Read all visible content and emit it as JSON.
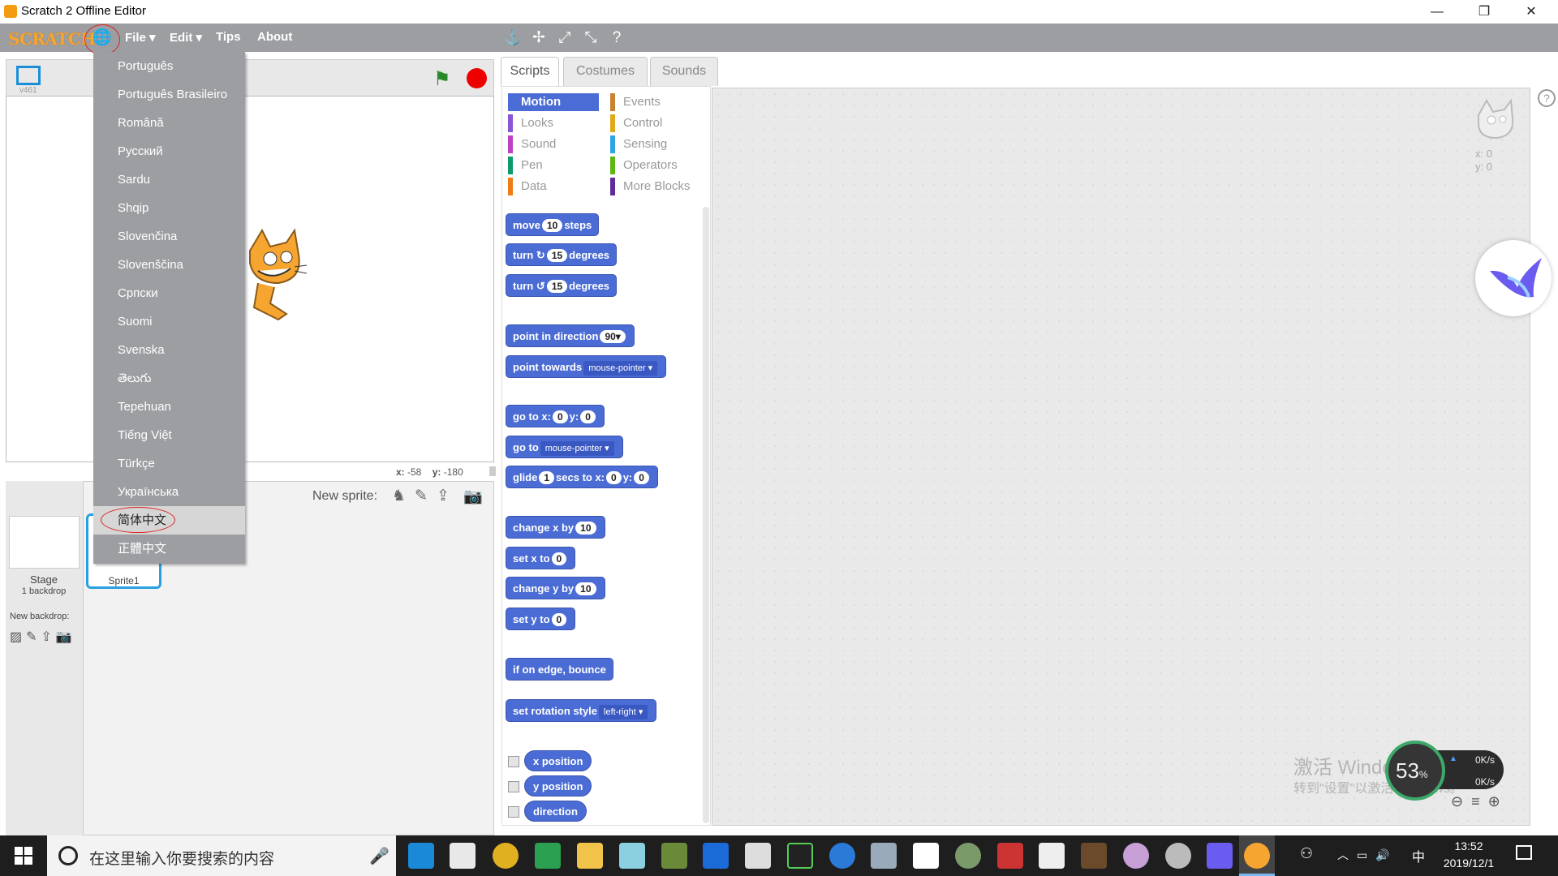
{
  "window": {
    "title": "Scratch 2 Offline Editor",
    "min": "—",
    "restore": "❐",
    "close": "✕"
  },
  "menubar": {
    "logo": "SCRATCH",
    "file": "File ▾",
    "edit": "Edit ▾",
    "tips": "Tips",
    "about": "About"
  },
  "language_menu": {
    "items": [
      "Português",
      "Português Brasileiro",
      "Română",
      "Русский",
      "Sardu",
      "Shqip",
      "Slovenčina",
      "Slovenščina",
      "Српски",
      "Suomi",
      "Svenska",
      "తెలుగు",
      "Tepehuan",
      "Tiếng Việt",
      "Türkçe",
      "Українська",
      "简体中文",
      "正體中文"
    ],
    "highlighted": "简体中文"
  },
  "stage": {
    "version": "v461",
    "x_label": "x:",
    "x_value": "-58",
    "y_label": "y:",
    "y_value": "-180"
  },
  "sprites": {
    "new_sprite": "New sprite:",
    "stage_label": "Stage",
    "stage_sub": "1 backdrop",
    "new_backdrop": "New backdrop:",
    "sprite_name": "Sprite1"
  },
  "tabs": [
    "Scripts",
    "Costumes",
    "Sounds"
  ],
  "categories": {
    "left": [
      {
        "label": "Motion",
        "color": "#4a6cd4"
      },
      {
        "label": "Looks",
        "color": "#8a55d7"
      },
      {
        "label": "Sound",
        "color": "#bb42c3"
      },
      {
        "label": "Pen",
        "color": "#0e9a6c"
      },
      {
        "label": "Data",
        "color": "#ee7d16"
      }
    ],
    "right": [
      {
        "label": "Events",
        "color": "#c88330"
      },
      {
        "label": "Control",
        "color": "#e1a91a"
      },
      {
        "label": "Sensing",
        "color": "#2ca5e2"
      },
      {
        "label": "Operators",
        "color": "#5cb712"
      },
      {
        "label": "More Blocks",
        "color": "#632d99"
      }
    ]
  },
  "blocks": {
    "move": [
      "move",
      "10",
      "steps"
    ],
    "turn_right": [
      "turn",
      "↻",
      "15",
      "degrees"
    ],
    "turn_left": [
      "turn",
      "↺",
      "15",
      "degrees"
    ],
    "point_dir": [
      "point in direction",
      "90▾"
    ],
    "point_towards": [
      "point towards",
      "mouse-pointer ▾"
    ],
    "goto_xy": [
      "go to x:",
      "0",
      "y:",
      "0"
    ],
    "goto": [
      "go to",
      "mouse-pointer ▾"
    ],
    "glide": [
      "glide",
      "1",
      "secs to x:",
      "0",
      "y:",
      "0"
    ],
    "change_x": [
      "change x by",
      "10"
    ],
    "set_x": [
      "set x to",
      "0"
    ],
    "change_y": [
      "change y by",
      "10"
    ],
    "set_y": [
      "set y to",
      "0"
    ],
    "bounce": "if on edge, bounce",
    "rotation": [
      "set rotation style",
      "left-right ▾"
    ],
    "rep_x": "x position",
    "rep_y": "y position",
    "rep_dir": "direction"
  },
  "sprite_info": {
    "x": "x: 0",
    "y": "y: 0"
  },
  "watermark": {
    "line1": "激活 Windows",
    "line2": "转到\"设置\"以激活 Windows。"
  },
  "netmeter": {
    "percent": "53",
    "unit": "%",
    "up": "0K/s",
    "down": "0K/s"
  },
  "taskbar": {
    "search_placeholder": "在这里输入你要搜索的内容",
    "time": "13:52",
    "date": "2019/12/1",
    "ime": "中"
  },
  "colors": {
    "menubar": "#9c9ea2",
    "motion": "#4a6cd4",
    "logo": "#f7a531"
  }
}
